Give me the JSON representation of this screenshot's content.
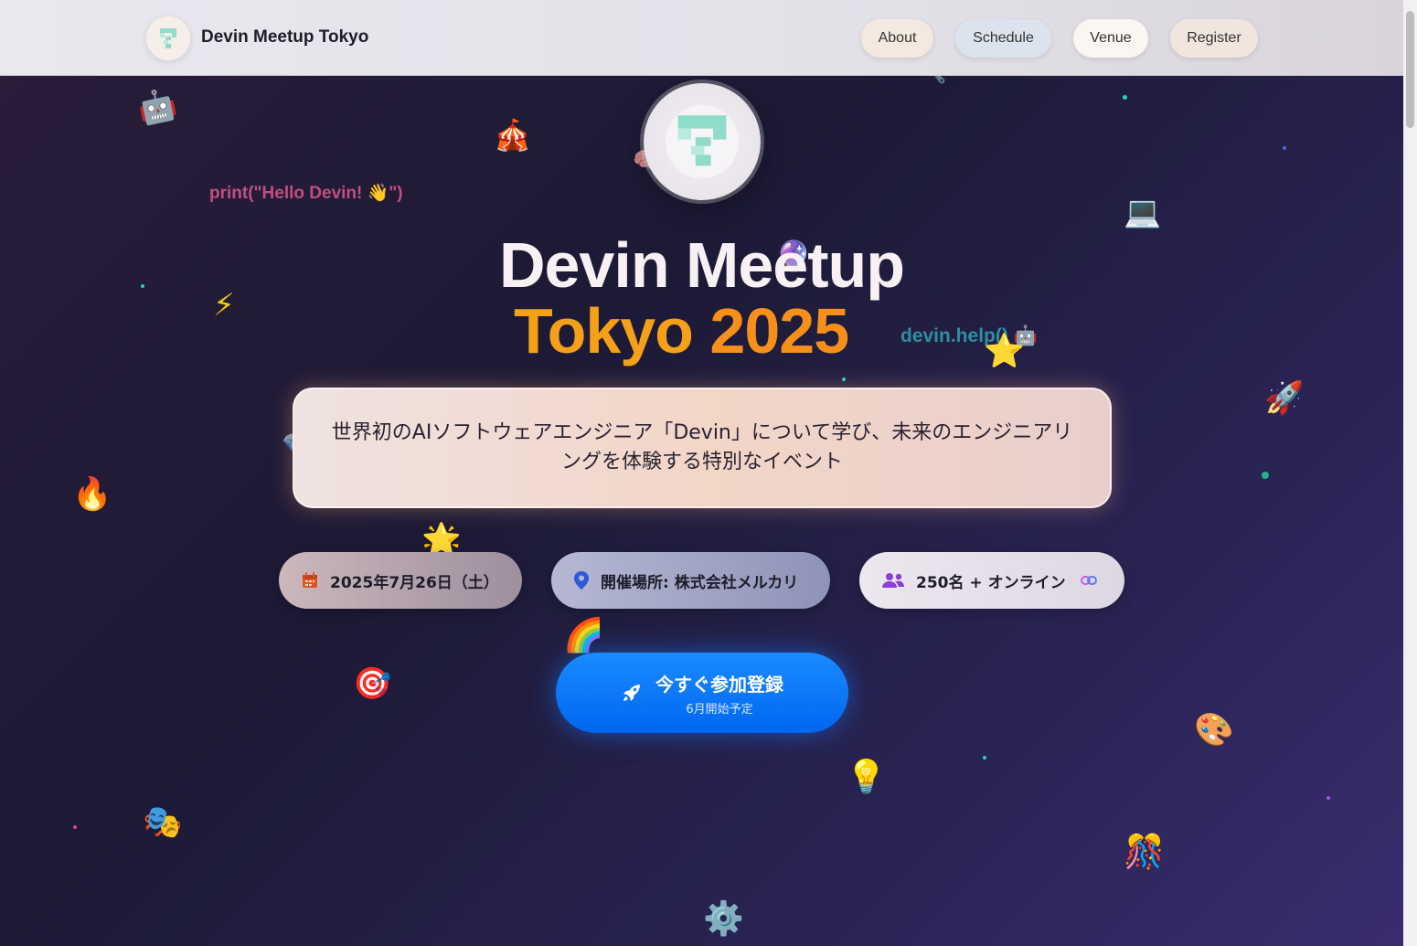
{
  "header": {
    "brand_title": "Devin Meetup Tokyo",
    "nav": {
      "about": "About",
      "schedule": "Schedule",
      "venue": "Venue",
      "register": "Register"
    }
  },
  "hero": {
    "title_line1": "Devin Meetup",
    "title_tokyo": "Tokyo",
    "title_year": "2025",
    "description": "世界初のAIソフトウェアエンジニア「Devin」について学び、未来のエンジニアリングを体験する特別なイベント",
    "info": {
      "date": "2025年7月26日（土）",
      "venue": "開催場所: 株式会社メルカリ",
      "capacity": "250名 + オンライン"
    },
    "cta": {
      "label": "今すぐ参加登録",
      "sub": "6月開始予定"
    }
  },
  "decor": {
    "code_snippet_1": "print(\"Hello Devin! 👋\")",
    "code_snippet_2": "devin.help() 🤖",
    "emojis": {
      "robot": "🤖",
      "circus": "🎪",
      "brain": "🧠",
      "laptop": "💻",
      "crystal_ball": "🔮",
      "lightning": "⚡",
      "star": "⭐",
      "rocket": "🚀",
      "fire": "🔥",
      "glowing_star": "🌟",
      "rainbow": "🌈",
      "target": "🎯",
      "bulb": "💡",
      "palette": "🎨",
      "masks": "🎭",
      "confetti": "🎊",
      "gear": "⚙️",
      "gem": "💎",
      "wrench": "🔧",
      "sparkles": "✨",
      "link": "🔗"
    }
  },
  "colors": {
    "accent_orange": "#f4a019",
    "cta_blue": "#0a78ff",
    "background_dark": "#1c1a35"
  }
}
